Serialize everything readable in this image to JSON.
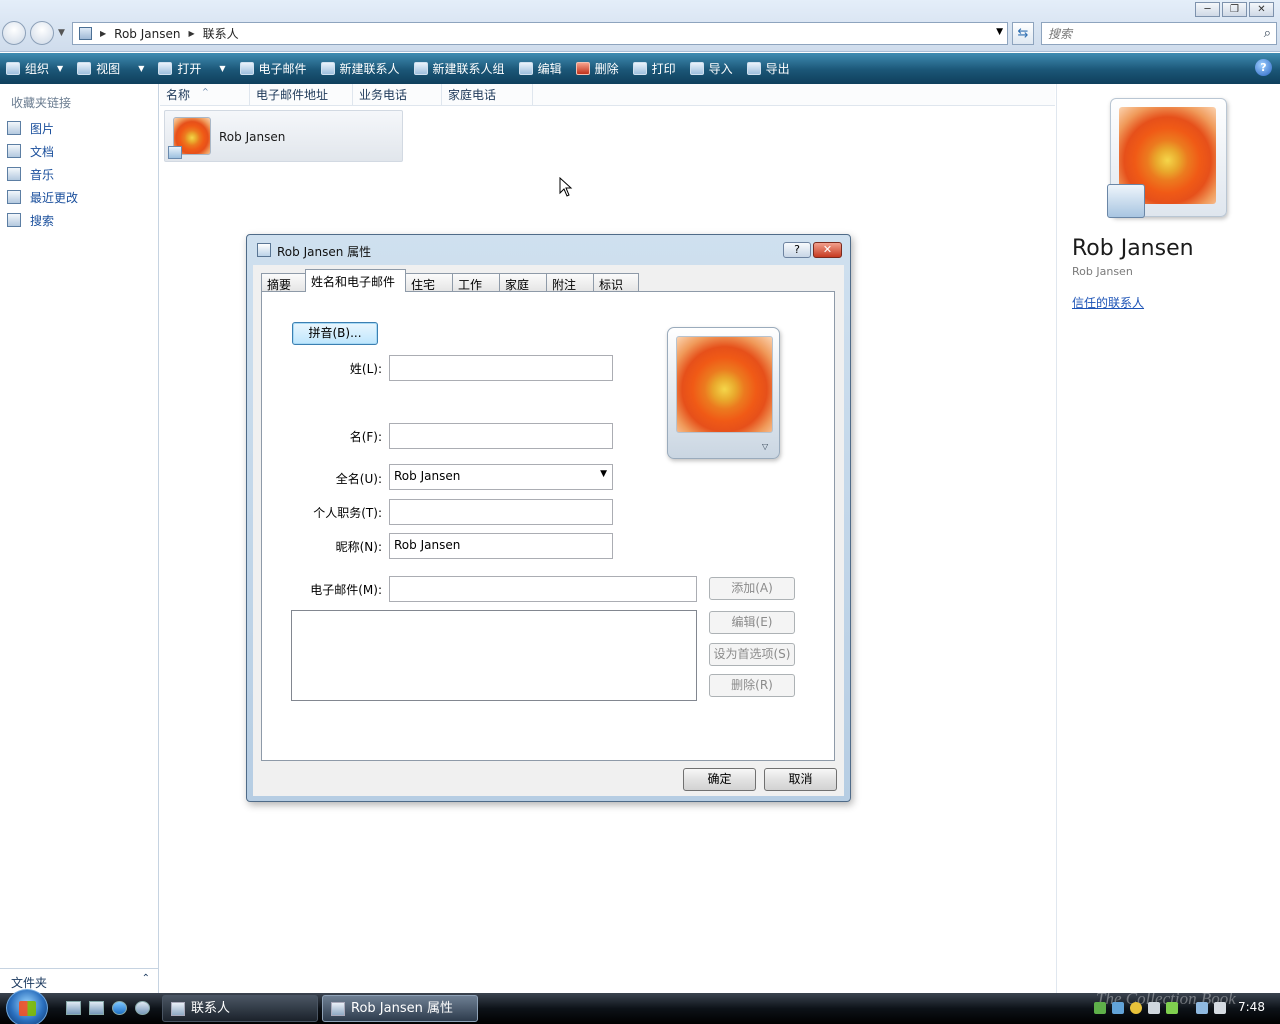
{
  "window": {
    "minimize": "─",
    "maximize": "❐",
    "close": "✕"
  },
  "address": {
    "crumbs": [
      "Rob Jansen",
      "联系人"
    ]
  },
  "search": {
    "placeholder": "搜索"
  },
  "toolbar": {
    "organize": "组织",
    "views": "视图",
    "open": "打开",
    "email": "电子邮件",
    "new_contact": "新建联系人",
    "new_group": "新建联系人组",
    "edit": "编辑",
    "delete": "删除",
    "print": "打印",
    "import": "导入",
    "export": "导出"
  },
  "nav": {
    "title": "收藏夹链接",
    "items": [
      "图片",
      "文档",
      "音乐",
      "最近更改",
      "搜索"
    ],
    "folders": "文件夹"
  },
  "columns": [
    "名称",
    "电子邮件地址",
    "业务电话",
    "家庭电话"
  ],
  "contact": {
    "name": "Rob Jansen"
  },
  "details": {
    "name": "Rob Jansen",
    "sub": "Rob Jansen",
    "trusted": "信任的联系人"
  },
  "dialog": {
    "title": "Rob Jansen 属性",
    "help": "?",
    "close": "✕",
    "tabs": [
      "摘要",
      "姓名和电子邮件",
      "住宅",
      "工作",
      "家庭",
      "附注",
      "标识"
    ],
    "pinyin_button": "拼音(B)...",
    "labels": {
      "last": "姓(L):",
      "first": "名(F):",
      "full": "全名(U):",
      "title": "个人职务(T):",
      "nickname": "昵称(N):",
      "email": "电子邮件(M):"
    },
    "values": {
      "last": "",
      "first": "",
      "full": "Rob Jansen",
      "title": "",
      "nickname": "Rob Jansen",
      "email": ""
    },
    "buttons": {
      "add": "添加(A)",
      "edit": "编辑(E)",
      "set_default": "设为首选项(S)",
      "remove": "删除(R)",
      "ok": "确定",
      "cancel": "取消"
    }
  },
  "taskbar": {
    "tasks": [
      "联系人",
      "Rob Jansen 属性"
    ],
    "clock": "7:48",
    "watermark": "The Collection Book"
  }
}
